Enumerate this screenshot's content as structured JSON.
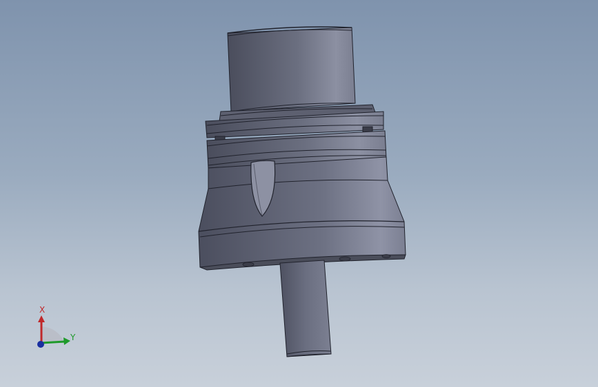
{
  "viewport": {
    "background_top": "#7f93ad",
    "background_bottom": "#c8d0da"
  },
  "model": {
    "body_color": "#5f6272",
    "highlight_color": "#8c90a2",
    "edge_color": "#20222c"
  },
  "triad": {
    "x_label": "X",
    "y_label": "Y",
    "x_color": "#c0282a",
    "y_color": "#1e9a2a",
    "z_color": "#1a2fa0"
  }
}
